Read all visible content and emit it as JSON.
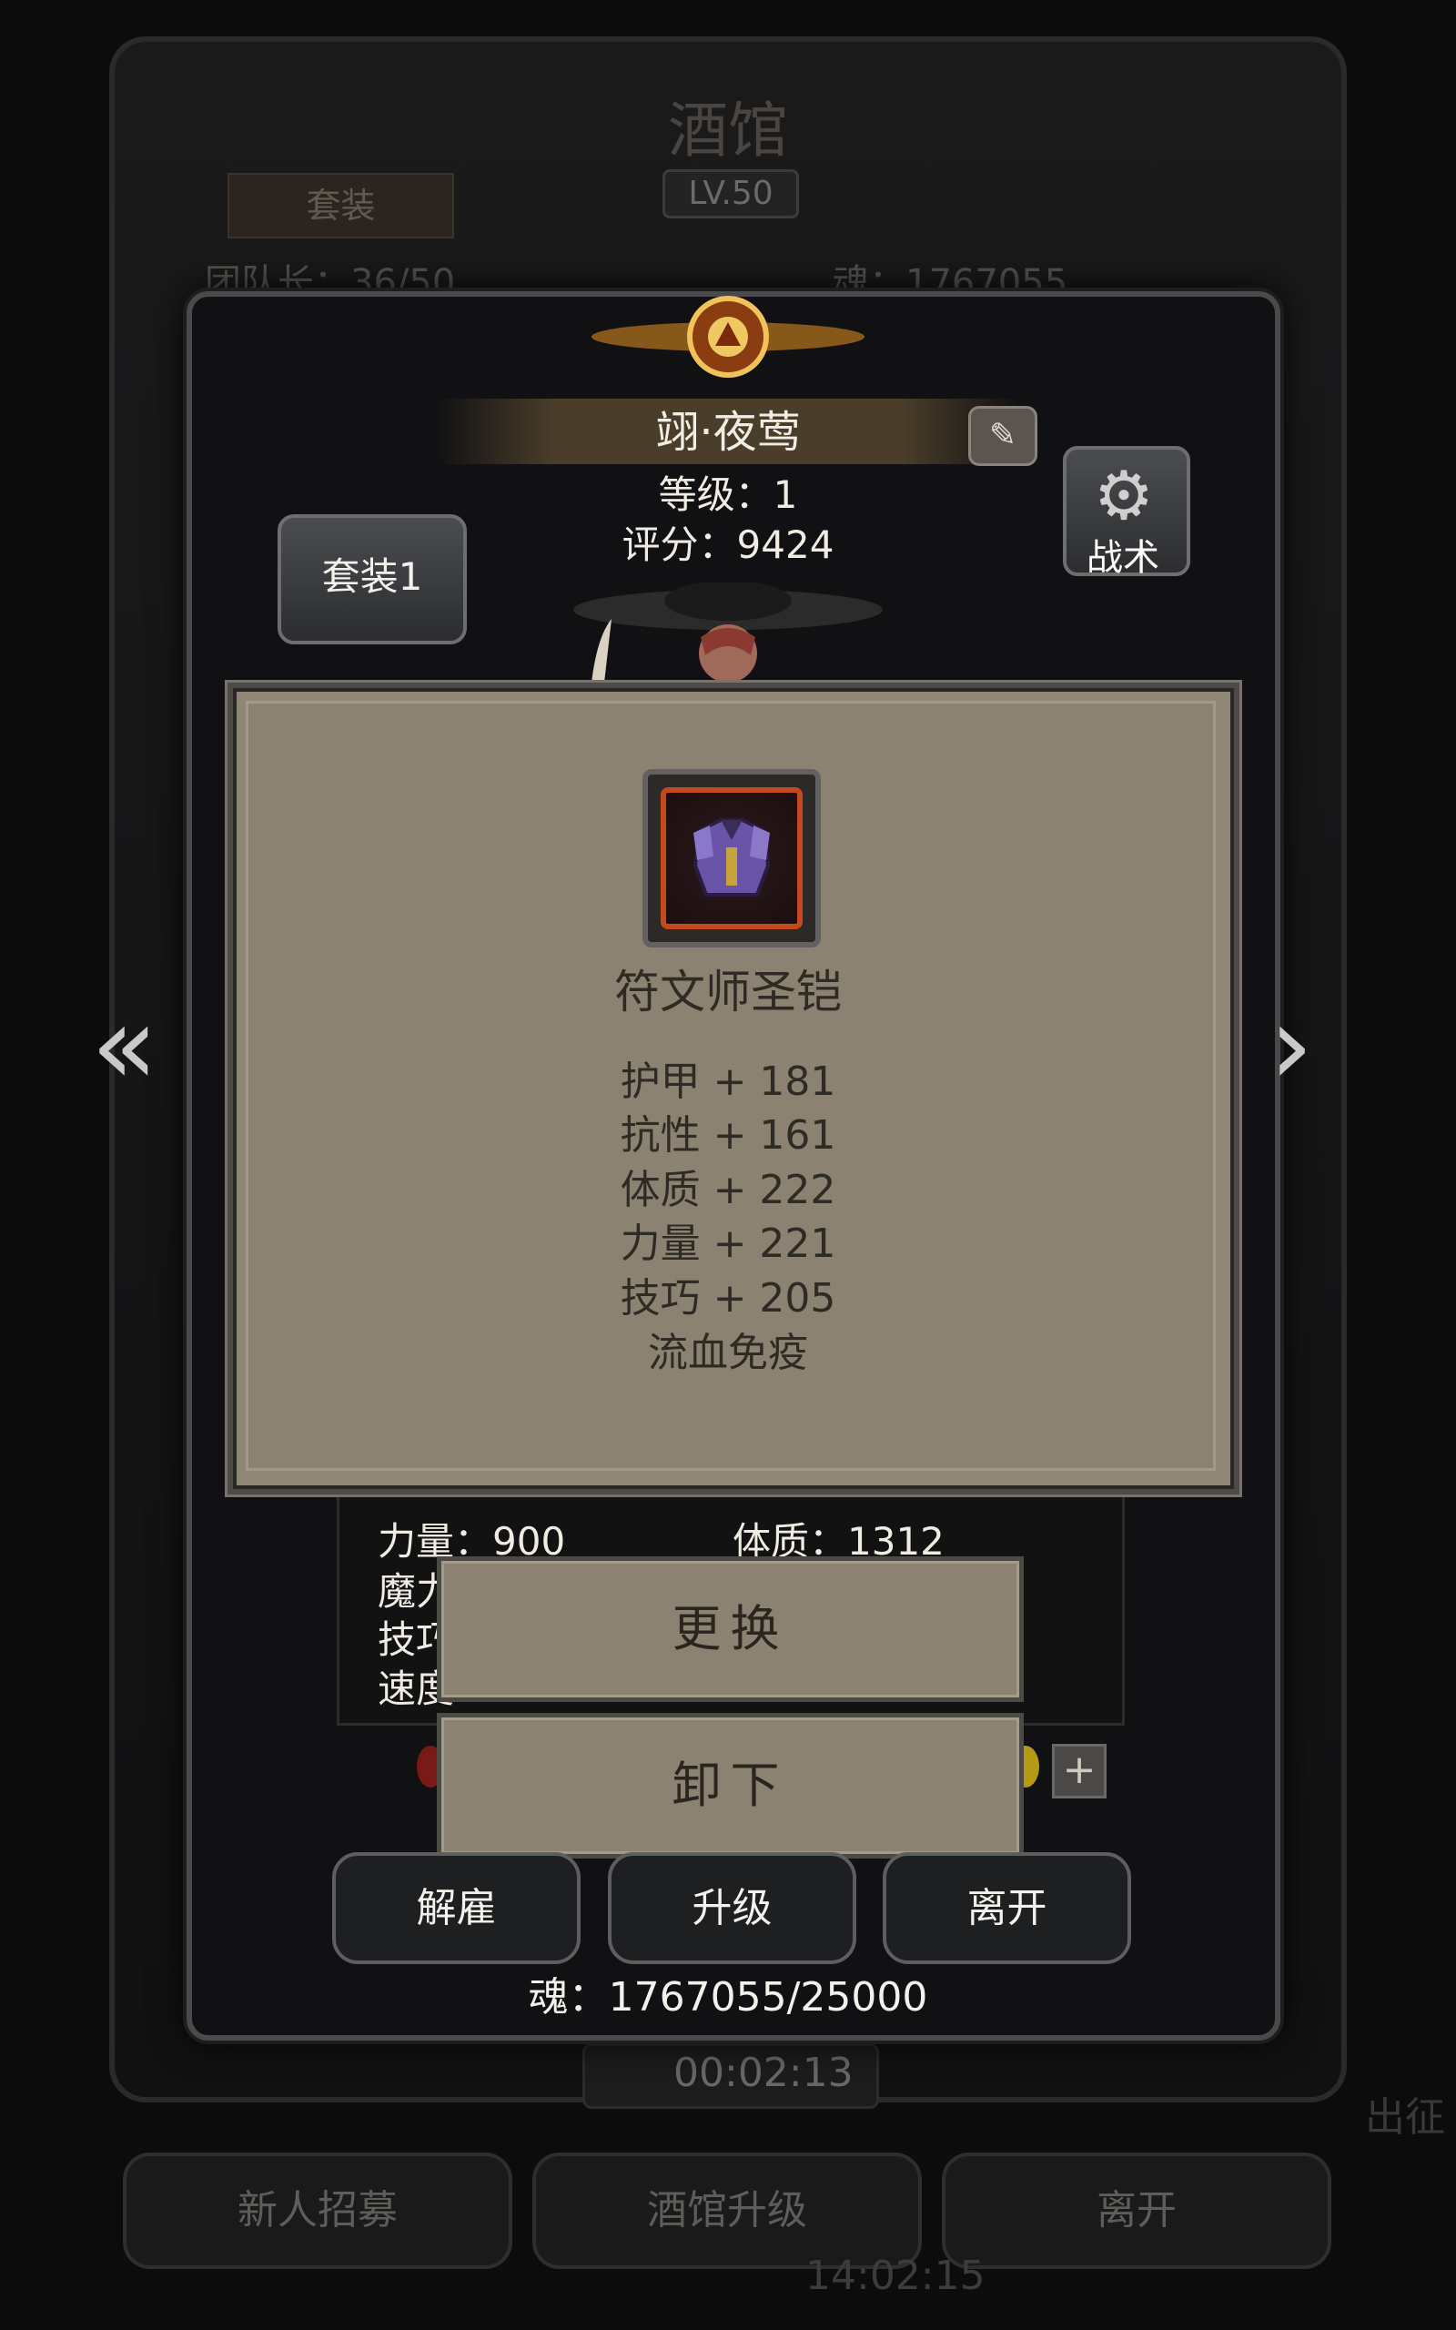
{
  "background": {
    "title": "酒馆",
    "level": "LV.50",
    "tab_label": "套装",
    "left_stat": "团队长：36/50",
    "right_stat": "魂：1767055",
    "timer": "00:02:13",
    "clock": "14:02:15",
    "side_label": "出征",
    "buttons": [
      "新人招募",
      "酒馆升级",
      "离开"
    ]
  },
  "hero": {
    "name": "翊·夜莺",
    "level_text": "等级：1",
    "score_text": "评分：9424",
    "suit_button": "套装1",
    "tactic_button": "战术"
  },
  "item": {
    "name": "符文师圣铠",
    "stats": [
      "护甲 + 181",
      "抗性 + 161",
      "体质 + 222",
      "力量 + 221",
      "技巧 + 205",
      "流血免疫"
    ]
  },
  "attributes": {
    "strength": "力量：900",
    "constitution": "体质：1312",
    "magic_partial": "魔力",
    "skill_partial": "技巧",
    "speed_partial": "速度"
  },
  "actions": {
    "replace": "更换",
    "unequip": "卸下"
  },
  "bottom_buttons": {
    "dismiss": "解雇",
    "upgrade": "升级",
    "leave": "离开"
  },
  "soul_text": "魂：1767055/25000",
  "icons": {
    "edit": "edit-icon",
    "tactic": "gear-icon",
    "left": "double-chevron-left-icon",
    "right": "chevron-right-icon",
    "item": "armor-icon",
    "plus": "plus-icon"
  }
}
